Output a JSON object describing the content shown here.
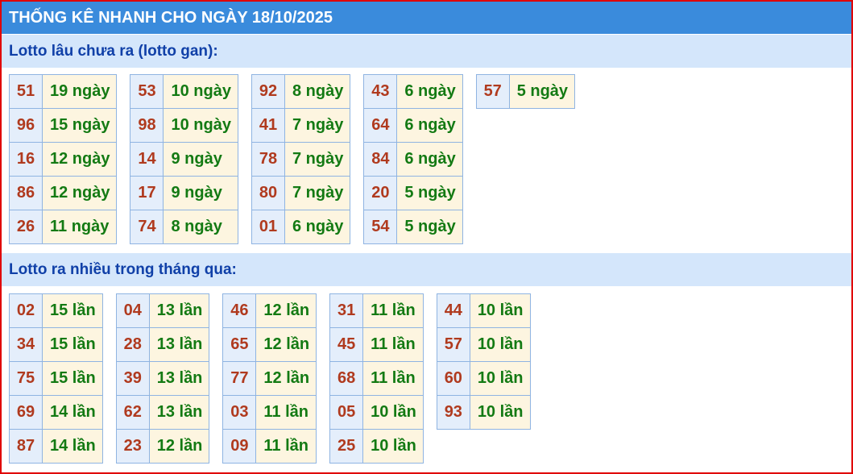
{
  "header": {
    "title": "THỐNG KÊ NHANH CHO NGÀY 18/10/2025"
  },
  "colors": {
    "header_bg": "#3a8bdc",
    "section_bg": "#d4e6fb",
    "section_text": "#1040a8",
    "number_text": "#b03a1e",
    "value_text": "#137a13",
    "border": "#e00000"
  },
  "gan": {
    "heading": "Lotto lâu chưa ra (lotto gan):",
    "groups": [
      [
        {
          "num": "51",
          "val": "19 ngày"
        },
        {
          "num": "96",
          "val": "15 ngày"
        },
        {
          "num": "16",
          "val": "12 ngày"
        },
        {
          "num": "86",
          "val": "12 ngày"
        },
        {
          "num": "26",
          "val": "11 ngày"
        }
      ],
      [
        {
          "num": "53",
          "val": "10 ngày"
        },
        {
          "num": "98",
          "val": "10 ngày"
        },
        {
          "num": "14",
          "val": "9 ngày"
        },
        {
          "num": "17",
          "val": "9 ngày"
        },
        {
          "num": "74",
          "val": "8 ngày"
        }
      ],
      [
        {
          "num": "92",
          "val": "8 ngày"
        },
        {
          "num": "41",
          "val": "7 ngày"
        },
        {
          "num": "78",
          "val": "7 ngày"
        },
        {
          "num": "80",
          "val": "7 ngày"
        },
        {
          "num": "01",
          "val": "6 ngày"
        }
      ],
      [
        {
          "num": "43",
          "val": "6 ngày"
        },
        {
          "num": "64",
          "val": "6 ngày"
        },
        {
          "num": "84",
          "val": "6 ngày"
        },
        {
          "num": "20",
          "val": "5 ngày"
        },
        {
          "num": "54",
          "val": "5 ngày"
        }
      ],
      [
        {
          "num": "57",
          "val": "5 ngày"
        }
      ]
    ]
  },
  "frequent": {
    "heading": "Lotto ra nhiều trong tháng qua:",
    "groups": [
      [
        {
          "num": "02",
          "val": "15 lần"
        },
        {
          "num": "34",
          "val": "15 lần"
        },
        {
          "num": "75",
          "val": "15 lần"
        },
        {
          "num": "69",
          "val": "14 lần"
        },
        {
          "num": "87",
          "val": "14 lần"
        }
      ],
      [
        {
          "num": "04",
          "val": "13 lần"
        },
        {
          "num": "28",
          "val": "13 lần"
        },
        {
          "num": "39",
          "val": "13 lần"
        },
        {
          "num": "62",
          "val": "13 lần"
        },
        {
          "num": "23",
          "val": "12 lần"
        }
      ],
      [
        {
          "num": "46",
          "val": "12 lần"
        },
        {
          "num": "65",
          "val": "12 lần"
        },
        {
          "num": "77",
          "val": "12 lần"
        },
        {
          "num": "03",
          "val": "11 lần"
        },
        {
          "num": "09",
          "val": "11 lần"
        }
      ],
      [
        {
          "num": "31",
          "val": "11 lần"
        },
        {
          "num": "45",
          "val": "11 lần"
        },
        {
          "num": "68",
          "val": "11 lần"
        },
        {
          "num": "05",
          "val": "10 lần"
        },
        {
          "num": "25",
          "val": "10 lần"
        }
      ],
      [
        {
          "num": "44",
          "val": "10 lần"
        },
        {
          "num": "57",
          "val": "10 lần"
        },
        {
          "num": "60",
          "val": "10 lần"
        },
        {
          "num": "93",
          "val": "10 lần"
        }
      ]
    ]
  }
}
